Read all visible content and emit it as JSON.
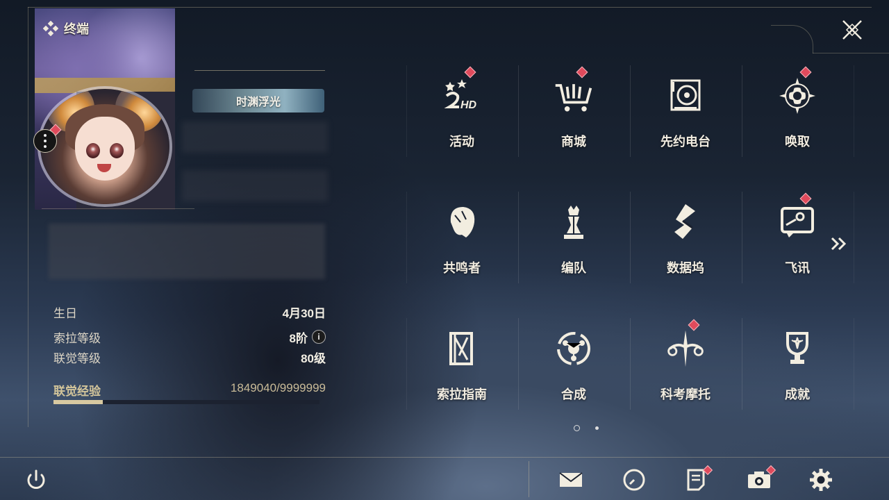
{
  "app": {
    "title": "终端"
  },
  "profile": {
    "title_badge": "时渊浮光",
    "stats": [
      {
        "label": "生日",
        "value": "4月30日"
      },
      {
        "label": "索拉等级",
        "value": "8阶"
      },
      {
        "label": "联觉等级",
        "value": "80级"
      }
    ],
    "exp": {
      "label": "联觉经验",
      "value": "1849040/9999999",
      "fraction": 0.1849
    }
  },
  "menu": {
    "page": 1,
    "pages": 2,
    "items": [
      {
        "label": "活动",
        "icon": "event-2hd-icon",
        "badge": true
      },
      {
        "label": "商城",
        "icon": "shopping-cart-icon",
        "badge": true
      },
      {
        "label": "先约电台",
        "icon": "radio-station-icon",
        "badge": false
      },
      {
        "label": "唤取",
        "icon": "compass-star-icon",
        "badge": true
      },
      {
        "label": "共鸣者",
        "icon": "resonator-head-icon",
        "badge": false
      },
      {
        "label": "编队",
        "icon": "chess-team-icon",
        "badge": false
      },
      {
        "label": "数据坞",
        "icon": "data-dock-icon",
        "badge": false
      },
      {
        "label": "飞讯",
        "icon": "message-chat-icon",
        "badge": true
      },
      {
        "label": "索拉指南",
        "icon": "guide-book-icon",
        "badge": false
      },
      {
        "label": "合成",
        "icon": "synthesis-icon",
        "badge": false
      },
      {
        "label": "科考摩托",
        "icon": "motorbike-icon",
        "badge": true
      },
      {
        "label": "成就",
        "icon": "trophy-icon",
        "badge": false
      }
    ]
  },
  "bottom_bar": [
    {
      "name": "mail",
      "icon": "mail-icon",
      "badge": false
    },
    {
      "name": "clock",
      "icon": "clock-icon",
      "badge": false
    },
    {
      "name": "notice",
      "icon": "notice-icon",
      "badge": true
    },
    {
      "name": "camera",
      "icon": "camera-icon",
      "badge": true
    },
    {
      "name": "settings",
      "icon": "gear-icon",
      "badge": false
    }
  ],
  "colors": {
    "accent": "#d8c9a1",
    "badge": "#e04a5c",
    "text": "#f1ece0"
  }
}
